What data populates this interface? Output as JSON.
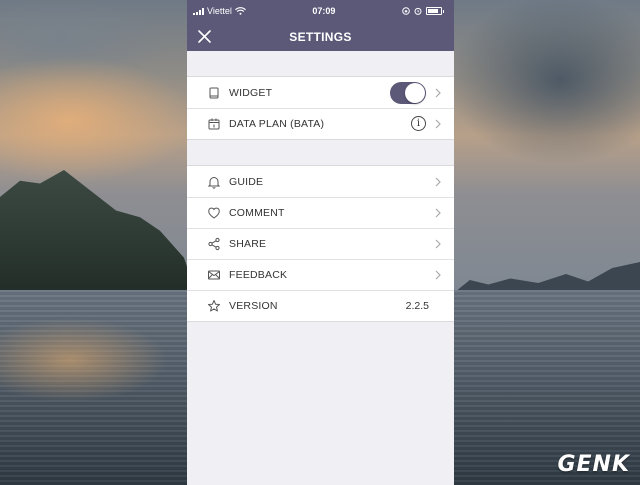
{
  "status_bar": {
    "carrier": "Viettel",
    "time": "07:09"
  },
  "header": {
    "title": "SETTINGS",
    "close_icon": "close-icon"
  },
  "groups": [
    {
      "items": [
        {
          "label": "WIDGET",
          "icon": "widget-icon",
          "accessory": "toggle",
          "toggle_on": true
        },
        {
          "label": "DATA PLAN (BATA)",
          "icon": "calendar-icon",
          "accessory": "info",
          "info_glyph": "i"
        }
      ]
    },
    {
      "items": [
        {
          "label": "GUIDE",
          "icon": "bell-icon"
        },
        {
          "label": "COMMENT",
          "icon": "heart-icon"
        },
        {
          "label": "SHARE",
          "icon": "share-icon"
        },
        {
          "label": "FEEDBACK",
          "icon": "mail-icon"
        },
        {
          "label": "VERSION",
          "icon": "star-icon",
          "value": "2.2.5"
        }
      ]
    }
  ],
  "watermark": "GENK",
  "colors": {
    "accent": "#5b5878",
    "background": "#efeff4"
  }
}
